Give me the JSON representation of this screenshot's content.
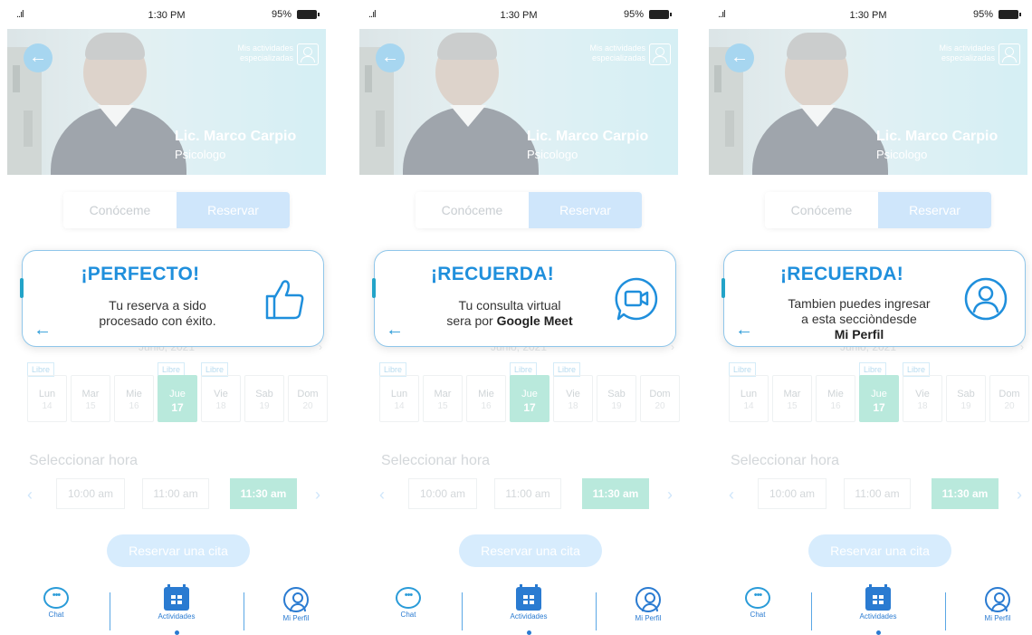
{
  "status_bar": {
    "signal": "..ıl",
    "time": "1:30 PM",
    "battery": "95%"
  },
  "hero": {
    "back": "←",
    "mis_actividades_line1": "Mis actividades",
    "mis_actividades_line2": "especializadas",
    "name": "Lic. Marco Carpio",
    "role": "Psicologo"
  },
  "tabs": {
    "conoceme": "Conóceme",
    "reservar": "Reservar"
  },
  "calendar": {
    "month": "Junio, 2021",
    "arrow": "›",
    "libre": "Libre",
    "days": [
      {
        "name": "Lun",
        "num": "14"
      },
      {
        "name": "Mar",
        "num": "15"
      },
      {
        "name": "Mie",
        "num": "16"
      },
      {
        "name": "Jue",
        "num": "17"
      },
      {
        "name": "Vie",
        "num": "18"
      },
      {
        "name": "Sab",
        "num": "19"
      },
      {
        "name": "Dom",
        "num": "20"
      }
    ]
  },
  "hours": {
    "title": "Seleccionar hora",
    "prev": "‹",
    "next": "›",
    "slots": [
      "10:00 am",
      "11:00 am",
      "11:30 am"
    ]
  },
  "cta": {
    "label": "Reservar una cita"
  },
  "nav": {
    "chat": "Chat",
    "actividades": "Actividades",
    "perfil": "Mi Perfil"
  },
  "modals": {
    "perfecto": {
      "title": "¡PERFECTO!",
      "line1": "Tu reserva a sido",
      "line2": "procesado con éxito.",
      "back": "←"
    },
    "recuerda_meet": {
      "title": "¡RECUERDA!",
      "line1": "Tu consulta virtual",
      "line2_prefix": "sera por ",
      "line2_bold": "Google Meet",
      "back": "←"
    },
    "recuerda_perfil": {
      "title": "¡RECUERDA!",
      "line1": "Tambien puedes ingresar",
      "line2": "a esta secciòndesde",
      "line3_bold": "Mi Perfil",
      "back": "←"
    }
  },
  "colors": {
    "accent": "#1f8fdc",
    "mint": "#b9e9dc",
    "light_blue": "#cfe6fb"
  }
}
